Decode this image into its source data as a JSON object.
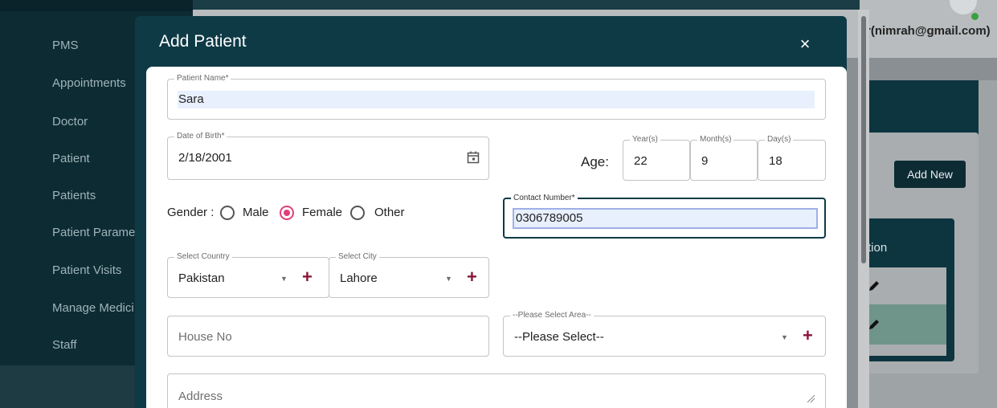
{
  "sidebar": {
    "items": [
      {
        "label": "PMS"
      },
      {
        "label": "Appointments"
      },
      {
        "label": "Doctor"
      },
      {
        "label": "Patient"
      },
      {
        "label": "Patients"
      },
      {
        "label": "Patient Paramet"
      },
      {
        "label": "Patient Visits"
      },
      {
        "label": "Manage Medici"
      },
      {
        "label": "Staff"
      }
    ]
  },
  "header": {
    "user_email": "r(nimrah@gmail.com)"
  },
  "background": {
    "add_new_label": "Add New",
    "action_header": "tion"
  },
  "modal": {
    "title": "Add Patient",
    "close_symbol": "×",
    "patient_name": {
      "label": "Patient Name*",
      "value": "Sara"
    },
    "dob": {
      "label": "Date of Birth*",
      "value": "2/18/2001",
      "icon": "calendar-icon"
    },
    "age": {
      "label": "Age:",
      "years": {
        "label": "Year(s)",
        "value": "22"
      },
      "months": {
        "label": "Month(s)",
        "value": "9"
      },
      "days": {
        "label": "Day(s)",
        "value": "18"
      }
    },
    "gender": {
      "label": "Gender :",
      "options": [
        {
          "label": "Male",
          "selected": false
        },
        {
          "label": "Female",
          "selected": true
        },
        {
          "label": "Other",
          "selected": false
        }
      ]
    },
    "contact": {
      "label": "Contact Number*",
      "value": "0306789005"
    },
    "country": {
      "label": "Select Country",
      "value": "Pakistan"
    },
    "city": {
      "label": "Select City",
      "value": "Lahore"
    },
    "house_no": {
      "placeholder": "House No"
    },
    "area": {
      "label": "--Please Select Area--",
      "value": "--Please Select--"
    },
    "address": {
      "placeholder": "Address"
    },
    "add_symbol": "+",
    "dropdown_symbol": "▼"
  },
  "colors": {
    "modal_header": "#0e3a46",
    "accent_radio": "#e0407a",
    "plus": "#8a1538",
    "sidebar": "#0d2b33"
  }
}
